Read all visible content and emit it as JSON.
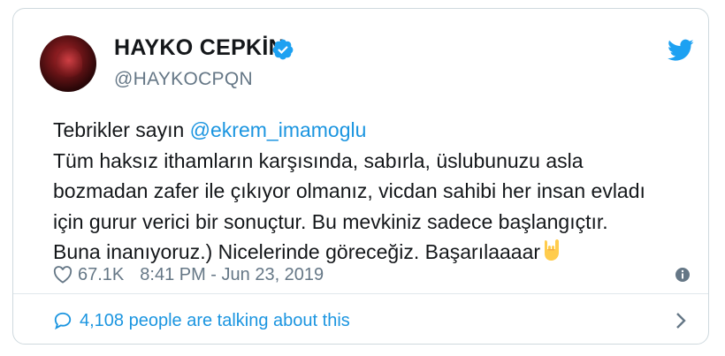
{
  "tweet": {
    "author": {
      "name": "HAYKO CEPKİN",
      "handle": "@HAYKOCPQN",
      "verified_icon": "verified-badge-icon",
      "avatar": "avatar-photo"
    },
    "platform_icon": "twitter-bird-icon",
    "text": {
      "line1_prefix": "Tebrikler sayın ",
      "mention": "@ekrem_imamoglu",
      "line2": "Tüm haksız ithamların karşısında, sabırla, üslubunuzu asla",
      "line3": "bozmadan zafer ile çıkıyor olmanız, vicdan sahibi her insan evladı",
      "line4": "için gurur verici bir sonuçtur. Bu mevkiniz sadece başlangıçtır.",
      "line5": "Buna inanıyoruz.) Nicelerinde göreceğiz. Başarılaaaar",
      "emoji": "sign-of-the-horns-emoji"
    },
    "likes": "67.1K",
    "timestamp": "8:41 PM - Jun 23, 2019",
    "talking": "4,108 people are talking about this"
  },
  "colors": {
    "accent": "#1b95e0",
    "muted": "#657786",
    "text": "#14171a",
    "border": "#cfd9de"
  }
}
